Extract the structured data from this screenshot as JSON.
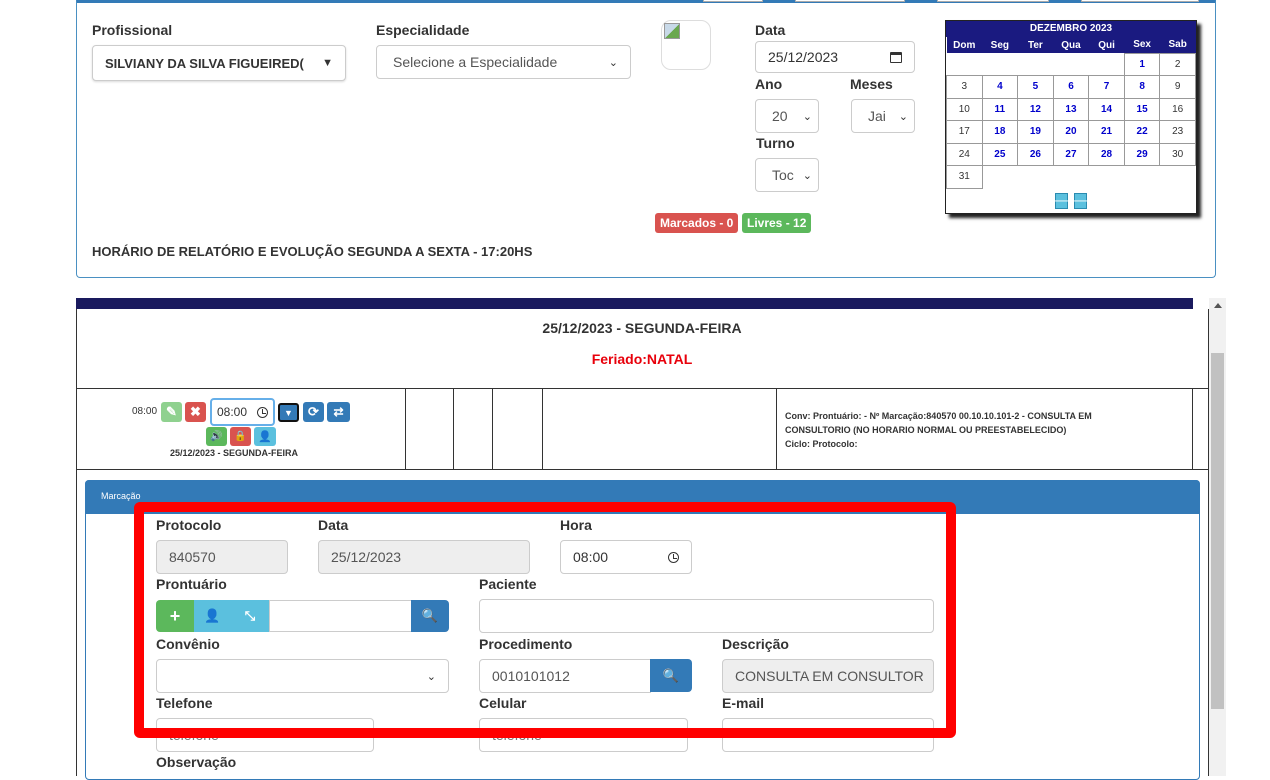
{
  "filters": {
    "professional_label": "Profissional",
    "professional_value": "SILVIANY DA SILVA FIGUEIRED(",
    "specialty_label": "Especialidade",
    "specialty_placeholder": "Selecione a Especialidade",
    "date_label": "Data",
    "date_value": "25/12/2023",
    "year_label": "Ano",
    "year_value": "20",
    "months_label": "Meses",
    "months_value": "Jai",
    "shift_label": "Turno",
    "shift_value": "Toc",
    "notice": "HORÁRIO DE RELATÓRIO E EVOLUÇÃO SEGUNDA A SEXTA - 17:20HS"
  },
  "badges": {
    "marked": "Marcados - 0",
    "free": "Livres - 12"
  },
  "calendar": {
    "title": "DEZEMBRO 2023",
    "weekdays": [
      "Dom",
      "Seg",
      "Ter",
      "Qua",
      "Qui",
      "Sex",
      "Sab"
    ],
    "weeks": [
      [
        "",
        "",
        "",
        "",
        "",
        "1",
        "2"
      ],
      [
        "3",
        "4",
        "5",
        "6",
        "7",
        "8",
        "9"
      ],
      [
        "10",
        "11",
        "12",
        "13",
        "14",
        "15",
        "16"
      ],
      [
        "17",
        "18",
        "19",
        "20",
        "21",
        "22",
        "23"
      ],
      [
        "24",
        "25",
        "26",
        "27",
        "28",
        "29",
        "30"
      ],
      [
        "31",
        "",
        "",
        "",
        "",
        "",
        ""
      ]
    ],
    "available_days": [
      "1",
      "4",
      "5",
      "6",
      "7",
      "8",
      "11",
      "12",
      "13",
      "14",
      "15",
      "18",
      "19",
      "20",
      "21",
      "22",
      "25",
      "26",
      "27",
      "28",
      "29"
    ],
    "prev_icon": "arrow-left-icon",
    "next_icon": "arrow-right-icon"
  },
  "agenda": {
    "date_title": "25/12/2023 - SEGUNDA-FEIRA",
    "holiday": "Feriado:NATAL",
    "slot_time": "08:00",
    "slot_input_time": "08:00",
    "slot_date": "25/12/2023 - SEGUNDA-FEIRA",
    "slot_info_line1": "Conv: Prontuário: - Nº Marcação:840570 00.10.10.101-2 - CONSULTA EM",
    "slot_info_line2": "CONSULTORIO (NO HORARIO NORMAL OU PREESTABELECIDO)",
    "slot_info_line3": "Ciclo: Protocolo:"
  },
  "form": {
    "panel_title": "Marcação",
    "protocol_label": "Protocolo",
    "protocol_value": "840570",
    "date_label": "Data",
    "date_value": "25/12/2023",
    "time_label": "Hora",
    "time_value": "08:00",
    "record_label": "Prontuário",
    "record_value": "",
    "patient_label": "Paciente",
    "patient_value": "",
    "insurance_label": "Convênio",
    "insurance_value": "",
    "procedure_label": "Procedimento",
    "procedure_value": "0010101012",
    "description_label": "Descrição",
    "description_value": "CONSULTA EM CONSULTOR",
    "phone_label": "Telefone",
    "phone_placeholder": "telefone",
    "mobile_label": "Celular",
    "mobile_placeholder": "telefone",
    "email_label": "E-mail",
    "email_value": "",
    "notes_label": "Observação"
  },
  "colors": {
    "primary": "#337ab7",
    "success": "#5cb85c",
    "danger": "#d9534f",
    "info": "#5bc0de",
    "holiday": "#e8000b",
    "highlight": "#ff0000",
    "navy": "#1a1a5e"
  }
}
